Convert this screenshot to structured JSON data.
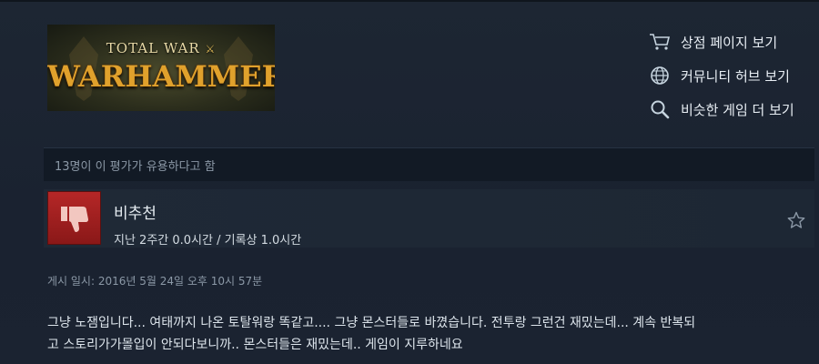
{
  "game": {
    "logo_line1": "TOTAL WAR",
    "logo_line2": "WARHAMMER"
  },
  "links": [
    {
      "icon": "cart-icon",
      "label": "상점 페이지 보기"
    },
    {
      "icon": "globe-icon",
      "label": "커뮤니티 허브 보기"
    },
    {
      "icon": "search-icon",
      "label": "비슷한 게임 더 보기"
    }
  ],
  "review": {
    "helpful_text": "13명이 이 평가가 유용하다고 함",
    "verdict": "비추천",
    "verdict_icon": "thumbs-down-icon",
    "verdict_color": "#b52727",
    "hours": "지난 2주간 0.0시간 / 기록상 1.0시간",
    "posted": "게시 일시: 2016년 5월 24일 오후 10시 57분",
    "body_line1": "그냥 노잼입니다... 여태까지 나온 토탈워랑 똑같고.... 그냥 몬스터들로 바꼈습니다. 전투랑 그런건 재밌는데... 계속 반복되",
    "body_line2": "고 스토리가가몰입이 안되다보니까.. 몬스터들은 재밌는데.. 게임이 지루하네요"
  }
}
